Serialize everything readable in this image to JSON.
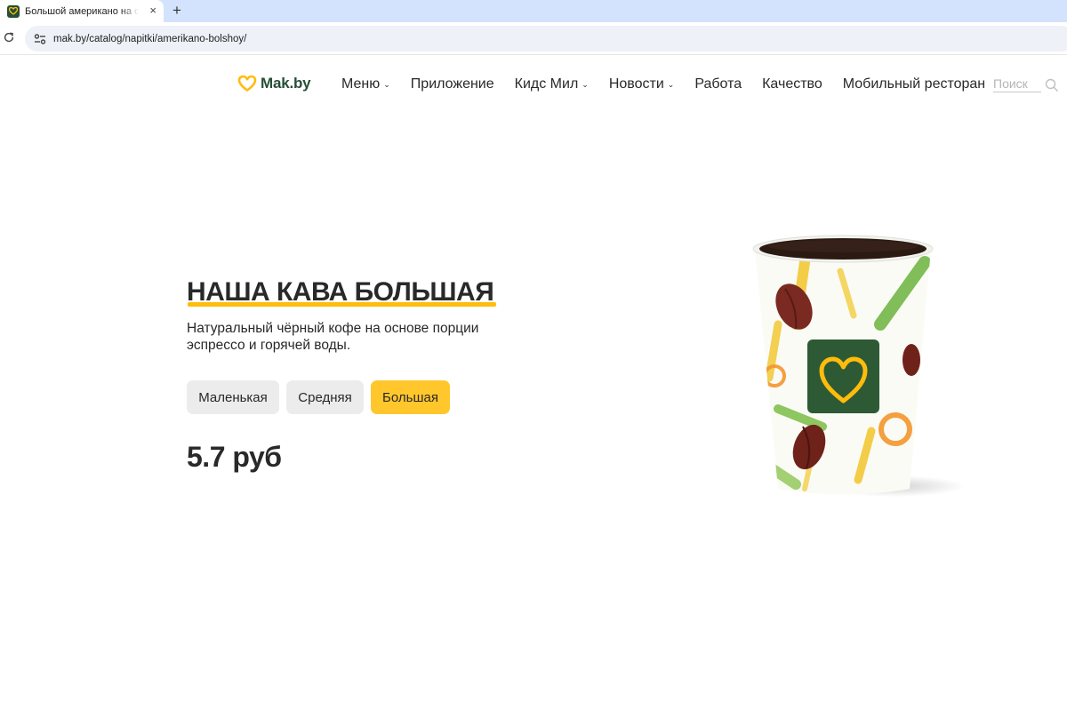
{
  "browser": {
    "tab_title": "Большой американо на осн",
    "new_tab_label": "+",
    "close_label": "×",
    "url": "mak.by/catalog/napitki/amerikano-bolshoy/"
  },
  "header": {
    "logo_text": "Mak.by",
    "nav": [
      {
        "label": "Меню",
        "has_dropdown": true
      },
      {
        "label": "Приложение",
        "has_dropdown": false
      },
      {
        "label": "Кидс Мил",
        "has_dropdown": true
      },
      {
        "label": "Новости",
        "has_dropdown": true
      },
      {
        "label": "Работа",
        "has_dropdown": false
      },
      {
        "label": "Качество",
        "has_dropdown": false
      },
      {
        "label": "Мобильный ресторан",
        "has_dropdown": false
      }
    ],
    "dropdown_glyph": "⌄",
    "search_placeholder": "Поиск"
  },
  "product": {
    "title": "НАША КАВА БОЛЬШАЯ",
    "description": "Натуральный чёрный кофе на основе порции эспрессо и горячей воды.",
    "sizes": [
      {
        "label": "Маленькая",
        "selected": false
      },
      {
        "label": "Средняя",
        "selected": false
      },
      {
        "label": "Большая",
        "selected": true
      }
    ],
    "price": "5.7 руб"
  },
  "colors": {
    "brand_green": "#264f36",
    "accent_yellow": "#ffbc0d",
    "selected_button": "#ffc72c",
    "unselected_button": "#ececec",
    "text": "#292929"
  },
  "icons": {
    "tab_favicon": "mak-heart-icon",
    "reload": "reload-icon",
    "site_info": "site-settings-icon",
    "search": "search-icon",
    "product_image": "coffee-cup-image"
  }
}
